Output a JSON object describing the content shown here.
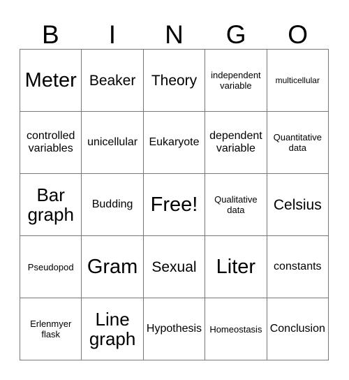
{
  "card": {
    "header_letters": [
      "B",
      "I",
      "N",
      "G",
      "O"
    ],
    "rows": [
      [
        {
          "label": "Meter",
          "size": "xl"
        },
        {
          "label": "Beaker",
          "size": "md"
        },
        {
          "label": "Theory",
          "size": "md"
        },
        {
          "label": "independent\nvariable",
          "size": "xs"
        },
        {
          "label": "multicellular",
          "size": "xxs"
        }
      ],
      [
        {
          "label": "controlled\nvariables",
          "size": "sm"
        },
        {
          "label": "unicellular",
          "size": "sm"
        },
        {
          "label": "Eukaryote",
          "size": "sm"
        },
        {
          "label": "dependent\nvariable",
          "size": "sm"
        },
        {
          "label": "Quantitative\ndata",
          "size": "xs"
        }
      ],
      [
        {
          "label": "Bar\ngraph",
          "size": "lg"
        },
        {
          "label": "Budding",
          "size": "sm"
        },
        {
          "label": "Free!",
          "size": "xl"
        },
        {
          "label": "Qualitative\ndata",
          "size": "xs"
        },
        {
          "label": "Celsius",
          "size": "md"
        }
      ],
      [
        {
          "label": "Pseudopod",
          "size": "xs"
        },
        {
          "label": "Gram",
          "size": "xl"
        },
        {
          "label": "Sexual",
          "size": "md"
        },
        {
          "label": "Liter",
          "size": "xl"
        },
        {
          "label": "constants",
          "size": "sm"
        }
      ],
      [
        {
          "label": "Erlenmyer\nflask",
          "size": "xs"
        },
        {
          "label": "Line\ngraph",
          "size": "lg"
        },
        {
          "label": "Hypothesis",
          "size": "sm"
        },
        {
          "label": "Homeostasis",
          "size": "xs"
        },
        {
          "label": "Conclusion",
          "size": "sm"
        }
      ]
    ],
    "free_space": "Free!",
    "colors": {
      "background": "#ffffff",
      "text": "#000000",
      "grid_line": "#777777"
    }
  }
}
